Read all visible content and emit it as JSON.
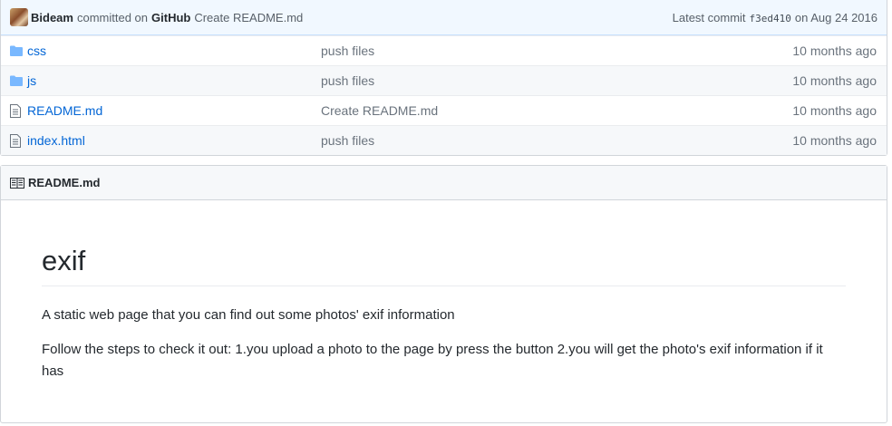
{
  "commit": {
    "author": "Bideam",
    "committed_on": "committed on",
    "via": "GitHub",
    "message": "Create README.md",
    "latest_label": "Latest commit",
    "sha": "f3ed410",
    "date_label": "on Aug 24 2016"
  },
  "files": [
    {
      "name": "css",
      "type": "folder",
      "message": "push files",
      "age": "10 months ago"
    },
    {
      "name": "js",
      "type": "folder",
      "message": "push files",
      "age": "10 months ago"
    },
    {
      "name": "README.md",
      "type": "file",
      "message": "Create README.md",
      "age": "10 months ago"
    },
    {
      "name": "index.html",
      "type": "file",
      "message": "push files",
      "age": "10 months ago"
    }
  ],
  "readme": {
    "header": "README.md",
    "title": "exif",
    "paragraphs": [
      "A static web page that you can find out some photos' exif information",
      "Follow the steps to check it out: 1.you upload a photo to the page by press the button 2.you will get the photo's exif information if it has"
    ]
  },
  "colors": {
    "link": "#0366d6",
    "folder_icon": "#79b8ff",
    "commit_bar": "#f1f8ff"
  }
}
